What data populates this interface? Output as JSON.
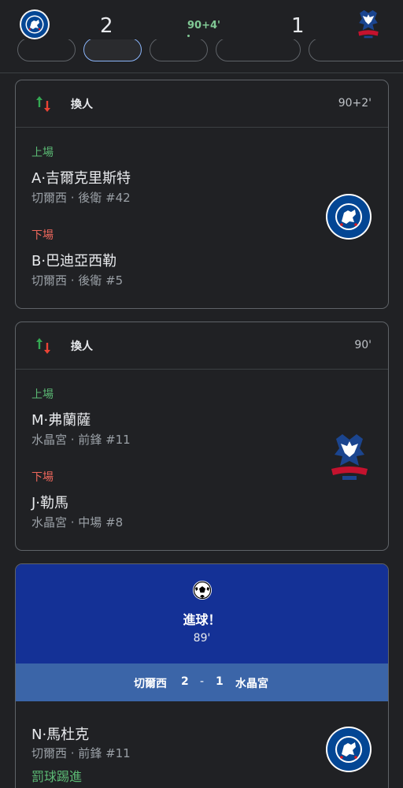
{
  "header": {
    "home_team": "切爾西",
    "away_team": "水晶宮",
    "home_score": "2",
    "away_score": "1",
    "match_time": "90+4'",
    "live_color": "#81c995"
  },
  "events": [
    {
      "type": "substitution",
      "title": "換人",
      "time": "90+2'",
      "in_label": "上場",
      "in_player": "A·吉爾克里斯特",
      "in_meta": "切爾西 · 後衛 #42",
      "out_label": "下場",
      "out_player": "B·巴迪亞西勒",
      "out_meta": "切爾西 · 後衛 #5",
      "team_crest": "chelsea-crest"
    },
    {
      "type": "substitution",
      "title": "換人",
      "time": "90'",
      "in_label": "上場",
      "in_player": "M·弗蘭薩",
      "in_meta": "水晶宮 · 前鋒 #11",
      "out_label": "下場",
      "out_player": "J·勒馬",
      "out_meta": "水晶宮 · 中場 #8",
      "team_crest": "crystal-palace-crest"
    },
    {
      "type": "goal",
      "title": "進球！",
      "time": "89'",
      "score_home_team": "切爾西",
      "score_home": "2",
      "score_sep": "-",
      "score_away": "1",
      "score_away_team": "水晶宮",
      "scorer": "N·馬杜克",
      "scorer_meta": "切爾西 · 前鋒 #11",
      "goal_method": "罰球踢進",
      "team_crest": "chelsea-crest"
    }
  ],
  "colors": {
    "background": "#202124",
    "goal_banner": "#143196",
    "goal_score_bar": "#3b65a8",
    "in_green": "#5bb974",
    "out_red": "#ee675c"
  }
}
